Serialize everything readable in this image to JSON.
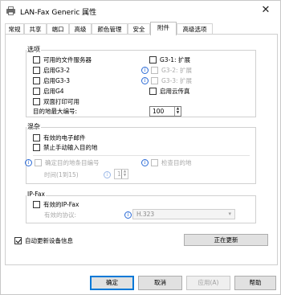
{
  "window": {
    "title": "LAN-Fax Generic 属性",
    "close_glyph": "✕"
  },
  "tabs": [
    "常规",
    "共享",
    "端口",
    "高级",
    "颜色管理",
    "安全",
    "附件",
    "高级选项"
  ],
  "options_group": {
    "title": "选项",
    "items": {
      "available_file_server": "可用的文件服务器",
      "g3_1_ext": "G3-1: 扩展",
      "enable_g3_2": "启用G3-2",
      "g3_2_ext": "G3-2: 扩展",
      "enable_g3_3": "启用G3-3",
      "g3_3_ext": "G3-3: 扩展",
      "enable_g4": "启用G4",
      "enable_cloud_fax": "启用云传真",
      "duplex_printing": "双面打印可用",
      "max_destinations_label": "目的地最大编号:",
      "max_destinations_value": "100"
    }
  },
  "misc_group": {
    "title": "混杂",
    "items": {
      "valid_email": "有效的电子邮件",
      "prohibit_manual_dest": "禁止手动输入目的地",
      "confirm_dest_number": "确定目的地条目编号",
      "check_destination": "检查目的地",
      "time_label": "时间(1到15)",
      "time_value": "1"
    }
  },
  "ipfax_group": {
    "title": "IP-Fax",
    "items": {
      "valid_ipfax": "有效的IP-Fax",
      "protocol_label": "有效的协议:",
      "protocol_value": "H.323"
    }
  },
  "auto_update": {
    "label": "自动更新设备信息",
    "status_button": "正在更新"
  },
  "footer": {
    "ok": "确定",
    "cancel": "取消",
    "apply": "应用(A)",
    "help": "帮助"
  }
}
